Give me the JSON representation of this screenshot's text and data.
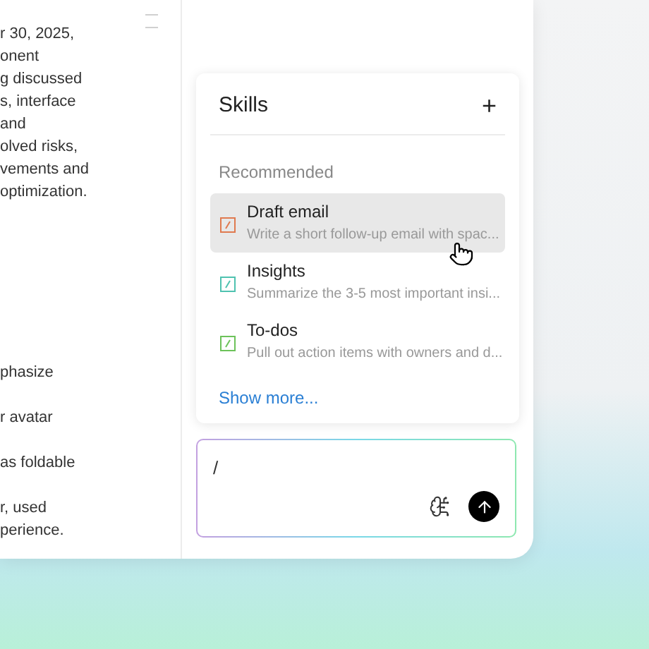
{
  "document": {
    "lines_top": [
      "r 30, 2025,",
      "onent",
      "g discussed",
      "s, interface",
      "and",
      "olved risks,",
      "vements and",
      "optimization."
    ],
    "paragraphs_bottom": [
      [
        "phasize"
      ],
      [
        "r avatar"
      ],
      [
        "as foldable"
      ],
      [
        "r, used",
        "perience."
      ]
    ]
  },
  "skills": {
    "title": "Skills",
    "add_label": "+",
    "section": "Recommended",
    "items": [
      {
        "name": "Draft email",
        "description": "Write a short follow-up email with spac...",
        "color": "#e07a4f",
        "selected": true
      },
      {
        "name": "Insights",
        "description": "Summarize the 3-5 most important insi...",
        "color": "#4fc2b0",
        "selected": false
      },
      {
        "name": "To-dos",
        "description": "Pull out action items with owners and d...",
        "color": "#6cc25a",
        "selected": false
      }
    ],
    "show_more": "Show more..."
  },
  "input": {
    "value": "/"
  }
}
